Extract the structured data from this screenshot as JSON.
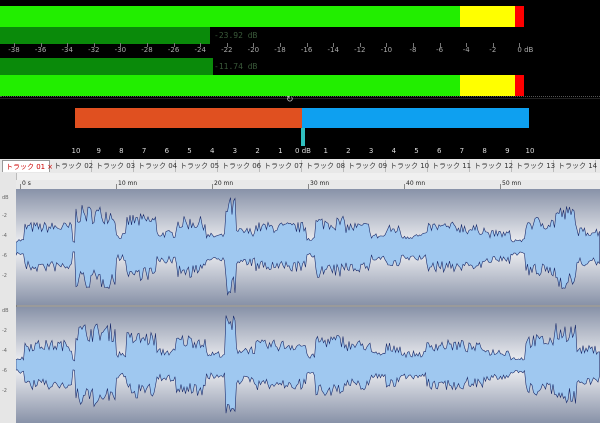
{
  "meters": {
    "readout_top": "-23.92 dB",
    "readout_bottom": "-11.74 dB",
    "scale_labels": [
      "-38",
      "-36",
      "-34",
      "-32",
      "-30",
      "-28",
      "-26",
      "-24",
      "-22",
      "-20",
      "-18",
      "-16",
      "-14",
      "-12",
      "-10",
      "-8",
      "-6",
      "-4",
      "-2",
      "0 dB"
    ],
    "colors": {
      "green": "#22ee00",
      "yellow": "#ffff00",
      "red": "#ff0000",
      "dark_green": "#0a8a0a"
    }
  },
  "pan": {
    "labels": [
      "10",
      "9",
      "8",
      "7",
      "6",
      "5",
      "4",
      "3",
      "2",
      "1",
      "0 dB",
      "1",
      "2",
      "3",
      "4",
      "5",
      "6",
      "7",
      "8",
      "9",
      "10"
    ],
    "colors": {
      "left": "#e05020",
      "right": "#0ea0f0",
      "marker": "#30c0c0"
    }
  },
  "tabs": [
    {
      "label": "トラック 01",
      "active": true,
      "close": "×"
    },
    {
      "label": "トラック 02"
    },
    {
      "label": "トラック 03"
    },
    {
      "label": "トラック 04"
    },
    {
      "label": "トラック 05"
    },
    {
      "label": "トラック 06"
    },
    {
      "label": "トラック 07"
    },
    {
      "label": "トラック 08"
    },
    {
      "label": "トラック 09"
    },
    {
      "label": "トラック 10"
    },
    {
      "label": "トラック 11"
    },
    {
      "label": "トラック 12"
    },
    {
      "label": "トラック 13"
    },
    {
      "label": "トラック 14"
    }
  ],
  "ruler": {
    "labels": [
      "0 s",
      "10 mn",
      "20 mn",
      "30 mn",
      "40 mn",
      "50 mn"
    ]
  },
  "waveform": {
    "colors": {
      "fill": "#9fc8f0",
      "stroke": "#1a2a6a"
    }
  }
}
